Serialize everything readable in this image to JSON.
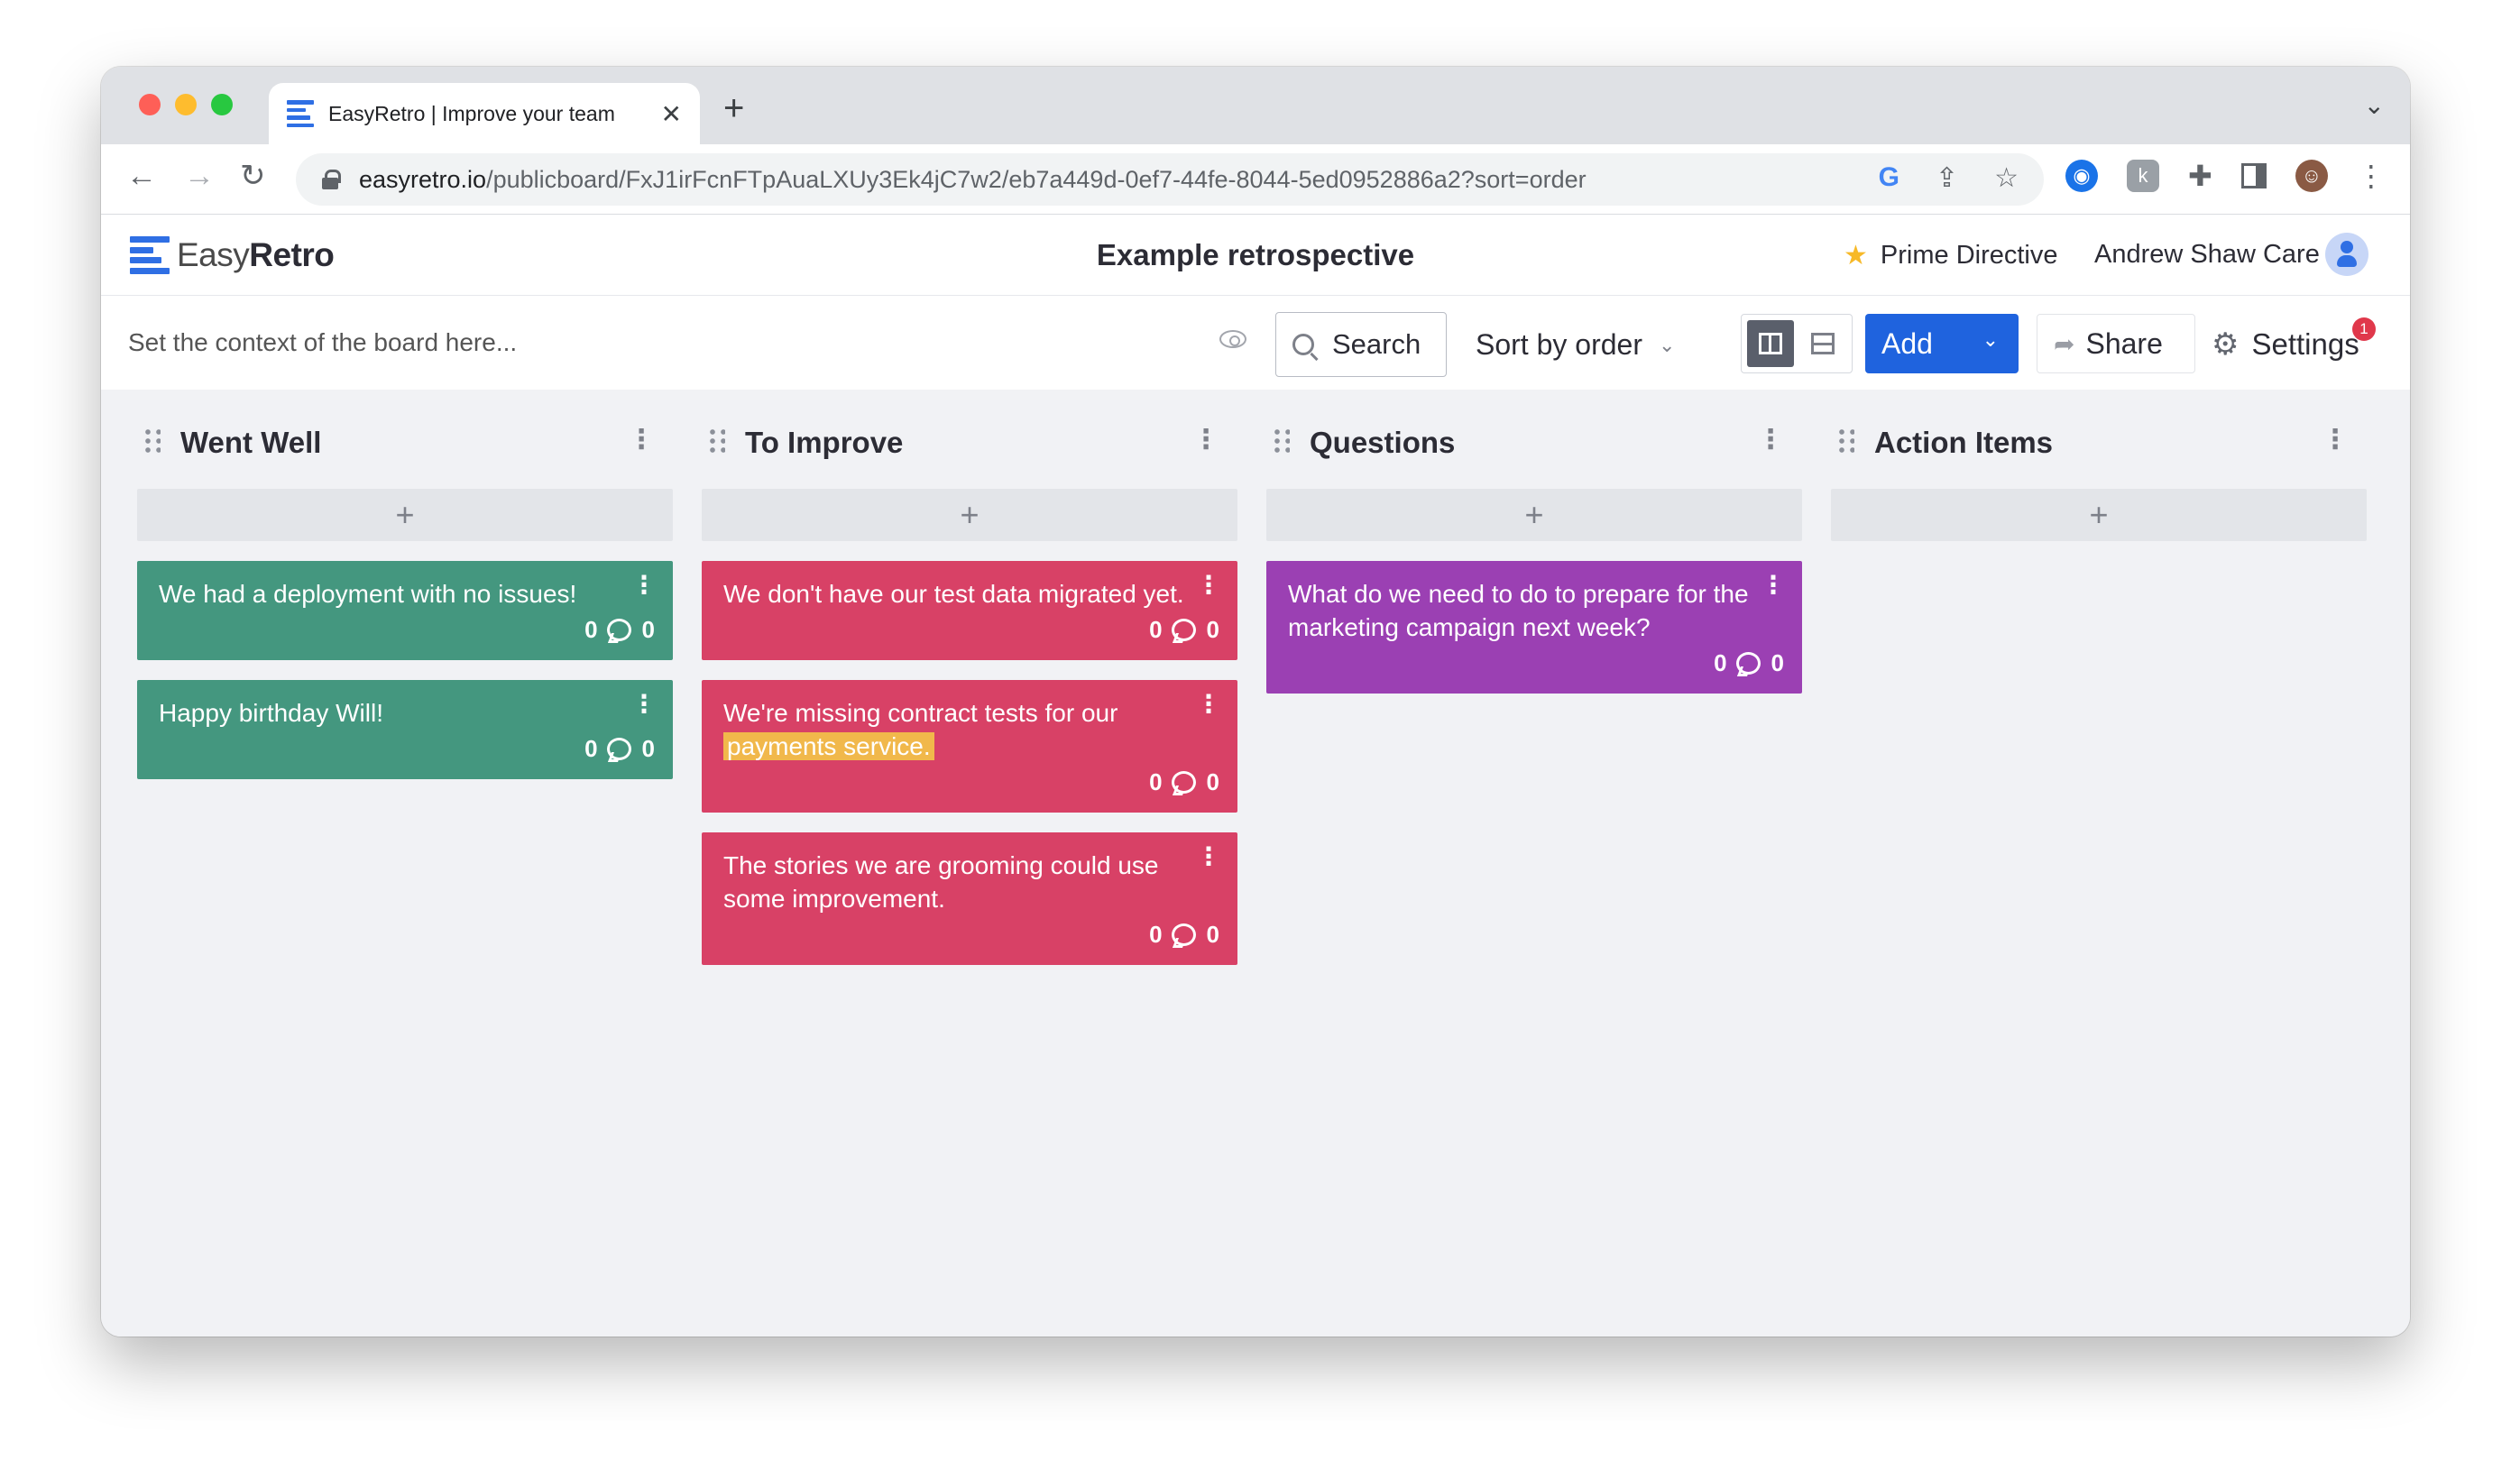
{
  "browser": {
    "tab_title": "EasyRetro | Improve your team",
    "url_host": "easyretro.io",
    "url_path": "/publicboard/FxJ1irFcnFTpAuaLXUy3Ek4jC7w2/eb7a449d-0ef7-44fe-8044-5ed0952886a2?sort=order",
    "new_tab": "+",
    "close_tab": "✕"
  },
  "header": {
    "logo_easy": "Easy",
    "logo_retro": "Retro",
    "board_title": "Example retrospective",
    "prime_directive": "Prime Directive",
    "user_name": "Andrew Shaw Care"
  },
  "toolbar": {
    "context_placeholder": "Set the context of the board here...",
    "search_label": "Search",
    "sort_label": "Sort by order",
    "add_label": "Add",
    "share_label": "Share",
    "settings_label": "Settings",
    "settings_badge": "1"
  },
  "columns": [
    {
      "title": "Went Well",
      "add": "+",
      "cards": [
        {
          "text": "We had a deployment with no issues!",
          "votes": "0",
          "comments": "0"
        },
        {
          "text": "Happy birthday Will!",
          "votes": "0",
          "comments": "0"
        }
      ]
    },
    {
      "title": "To Improve",
      "add": "+",
      "cards": [
        {
          "text": "We don't have our test data migrated yet.",
          "votes": "0",
          "comments": "0"
        },
        {
          "text": "We're missing contract tests for our",
          "highlight": "payments service.",
          "votes": "0",
          "comments": "0"
        },
        {
          "text": "The stories we are grooming could use some improvement.",
          "votes": "0",
          "comments": "0"
        }
      ]
    },
    {
      "title": "Questions",
      "add": "+",
      "cards": [
        {
          "text": "What do we need to do to prepare for the marketing campaign next week?",
          "votes": "0",
          "comments": "0"
        }
      ]
    },
    {
      "title": "Action Items",
      "add": "+",
      "cards": []
    }
  ],
  "colors": {
    "went_well": "#44977f",
    "to_improve": "#d84166",
    "questions": "#9b40b3",
    "accent": "#1f63de",
    "highlight": "#f1b84b"
  }
}
